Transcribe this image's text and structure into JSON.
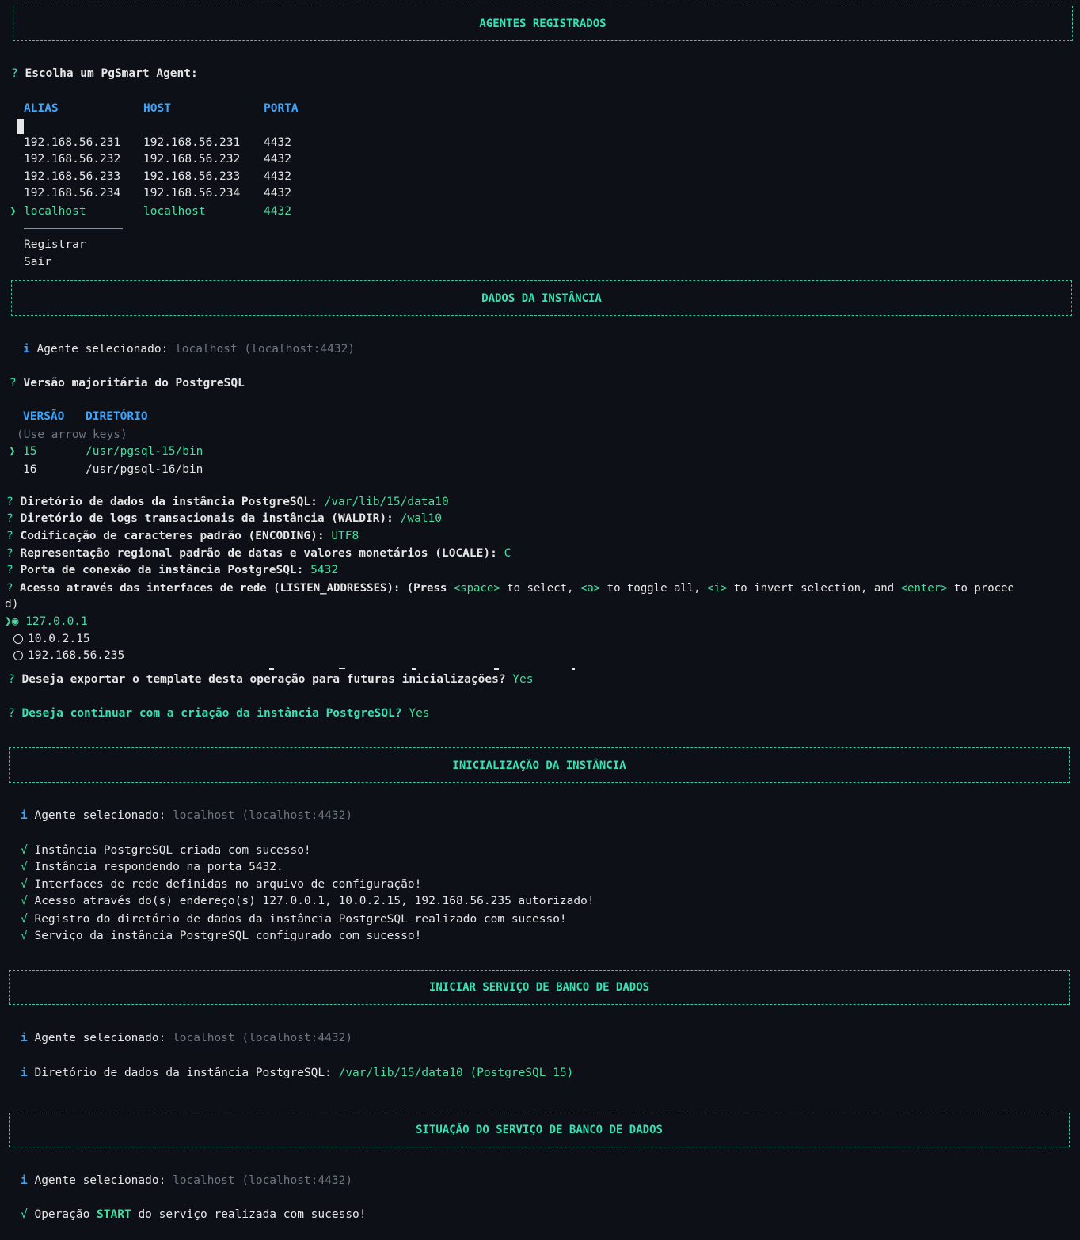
{
  "sections": {
    "agents": "AGENTES REGISTRADOS",
    "instance": "DADOS DA INSTÂNCIA",
    "init": "INICIALIZAÇÃO DA INSTÂNCIA",
    "start": "INICIAR SERVIÇO DE BANCO DE DADOS",
    "status": "SITUAÇÃO DO SERVIÇO DE BANCO DE DADOS"
  },
  "agents": {
    "prompt": "Escolha um PgSmart Agent:",
    "headers": {
      "alias": "ALIAS",
      "host": "HOST",
      "port": "PORTA"
    },
    "rows": [
      {
        "alias": "192.168.56.231",
        "host": "192.168.56.231",
        "port": "4432"
      },
      {
        "alias": "192.168.56.232",
        "host": "192.168.56.232",
        "port": "4432"
      },
      {
        "alias": "192.168.56.233",
        "host": "192.168.56.233",
        "port": "4432"
      },
      {
        "alias": "192.168.56.234",
        "host": "192.168.56.234",
        "port": "4432"
      },
      {
        "alias": "localhost",
        "host": "localhost",
        "port": "4432"
      }
    ],
    "actions": [
      "Registrar",
      "Sair"
    ]
  },
  "glyphs": {
    "question": "?",
    "pointer": "❯",
    "info": "i",
    "check": "√"
  },
  "agent_selected": {
    "label": "Agente selecionado:",
    "value": "localhost (localhost:4432)"
  },
  "version": {
    "prompt": "Versão majoritária do PostgreSQL",
    "headers": {
      "version": "VERSÃO",
      "dir": "DIRETÓRIO"
    },
    "hint": "(Use arrow keys)",
    "options": [
      {
        "version": "15",
        "dir": "/usr/pgsql-15/bin"
      },
      {
        "version": "16",
        "dir": "/usr/pgsql-16/bin"
      }
    ]
  },
  "questions": [
    {
      "label": "Diretório de dados da instância PostgreSQL:",
      "answer": "/var/lib/15/data10"
    },
    {
      "label": "Diretório de logs transacionais da instância (WALDIR):",
      "answer": "/wal10"
    },
    {
      "label": "Codificação de caracteres padrão (ENCODING):",
      "answer": "UTF8"
    },
    {
      "label": "Representação regional padrão de datas e valores monetários (LOCALE):",
      "answer": "C"
    },
    {
      "label": "Porta de conexão da instância PostgreSQL:",
      "answer": "5432"
    }
  ],
  "listen": {
    "label": "Acesso através das interfaces de rede (LISTEN_ADDRESSES): (Press",
    "k_space": "<space>",
    "t1": "to select,",
    "k_a": "<a>",
    "t2": "to toggle all,",
    "k_i": "<i>",
    "t3": "to invert selection, and",
    "k_enter": "<enter>",
    "t4": "to procee",
    "wrap": "d)",
    "checked_glyph": "◉",
    "options": [
      "127.0.0.1",
      "10.0.2.15",
      "192.168.56.235"
    ]
  },
  "export_q": {
    "label": "Deseja exportar o template desta operação para futuras inicializações?",
    "answer": "Yes"
  },
  "continue_q": {
    "label": "Deseja continuar com a criação da instância PostgreSQL?",
    "answer": "Yes"
  },
  "init_results": [
    "Instância PostgreSQL criada com sucesso!",
    "Instância respondendo na porta 5432.",
    "Interfaces de rede definidas no arquivo de configuração!",
    "Acesso através do(s) endereço(s) 127.0.0.1, 10.0.2.15, 192.168.56.235 autorizado!",
    "Registro do diretório de dados da instância PostgreSQL realizado com sucesso!",
    "Serviço da instância PostgreSQL configurado com sucesso!"
  ],
  "start_dir": {
    "label": "Diretório de dados da instância PostgreSQL:",
    "value": "/var/lib/15/data10 (PostgreSQL 15)"
  },
  "final": {
    "pre": "Operação",
    "keyword": "START",
    "post": "do serviço realizada com sucesso!"
  }
}
